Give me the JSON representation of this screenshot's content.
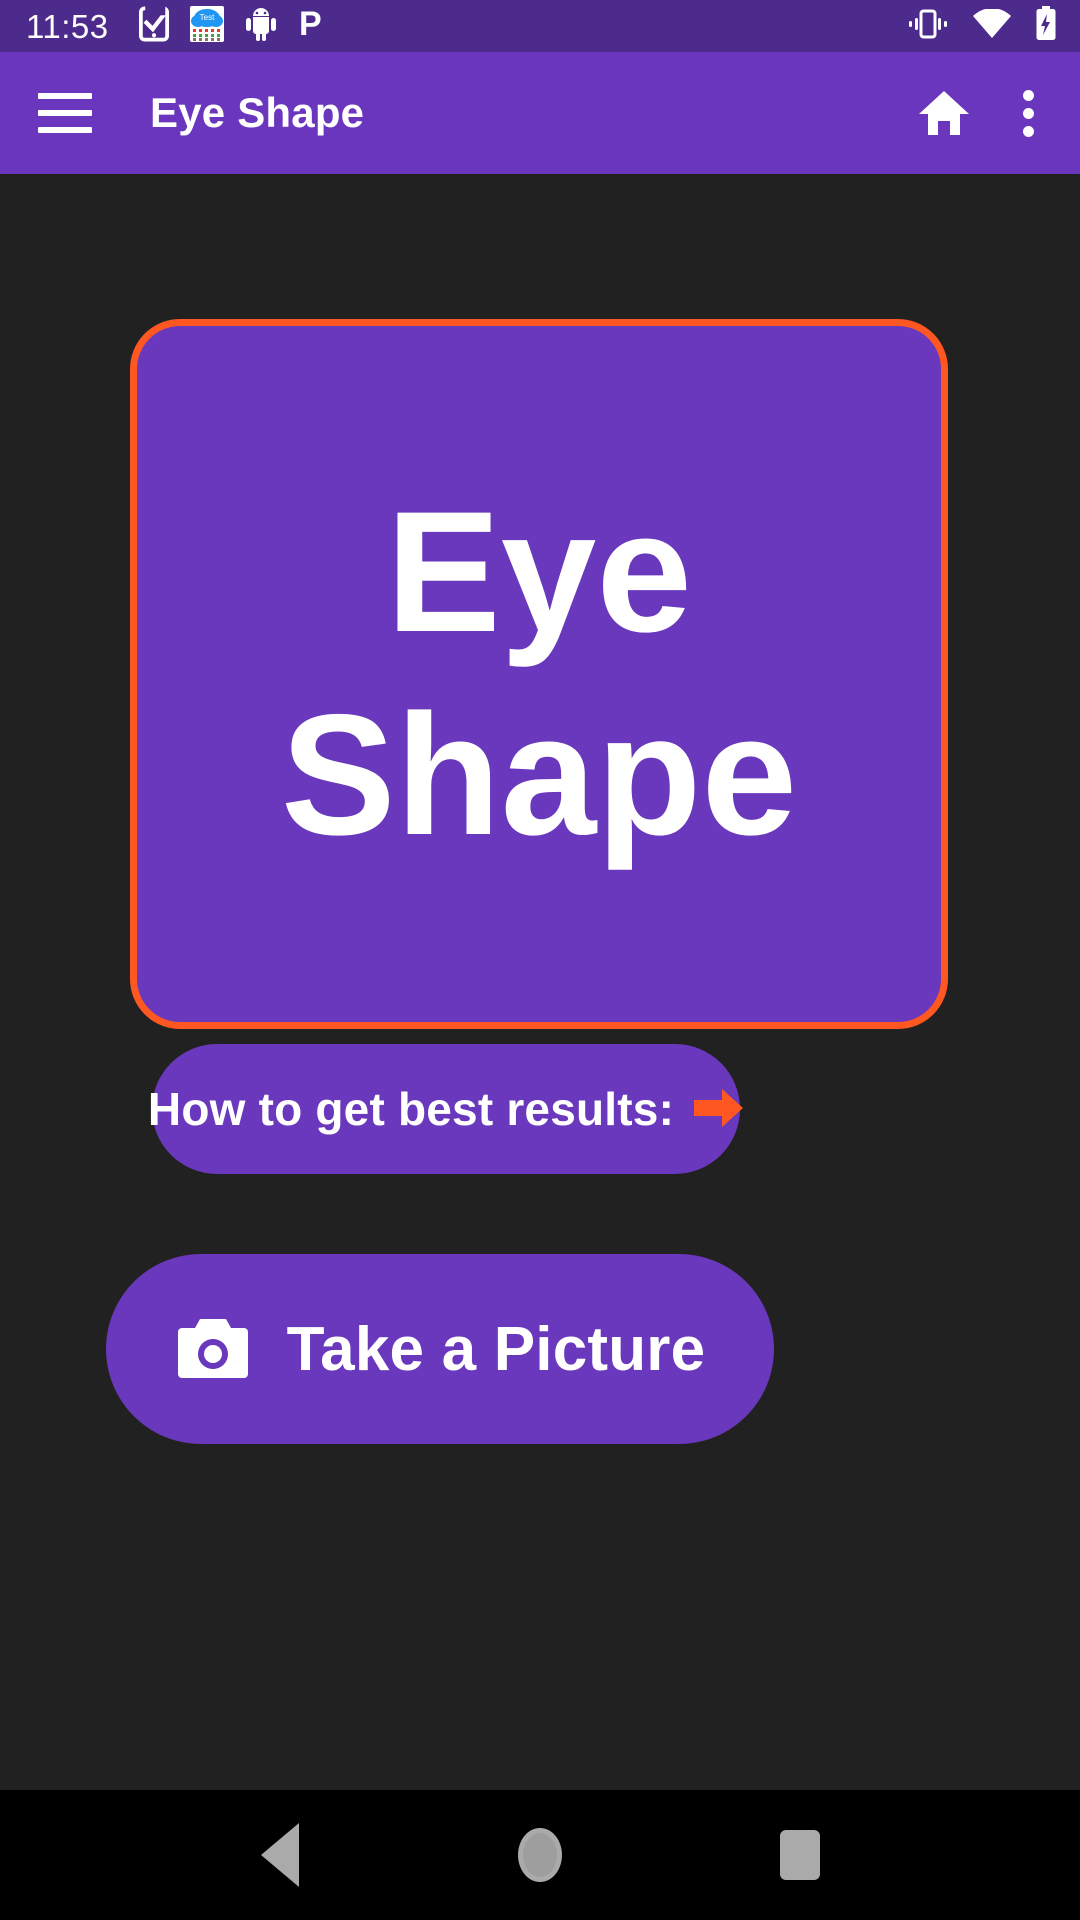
{
  "status_bar": {
    "time": "11:53",
    "background": "#4C2B8C",
    "notification_icons": [
      {
        "name": "phone-check-icon",
        "label": "phone with checkmark"
      },
      {
        "name": "weather-test-icon",
        "label": "Test"
      },
      {
        "name": "android-robot-icon",
        "label": "android"
      },
      {
        "name": "letter-p-icon",
        "label": "P"
      }
    ],
    "system_icons": [
      {
        "name": "vibrate-icon",
        "label": "vibrate"
      },
      {
        "name": "wifi-icon",
        "label": "wifi"
      },
      {
        "name": "battery-charging-icon",
        "label": "battery charging"
      }
    ]
  },
  "app_bar": {
    "title": "Eye Shape",
    "background": "#6A36BE",
    "menu_icon": "hamburger-icon",
    "home_icon": "home-icon",
    "overflow_icon": "more-vert-icon"
  },
  "main": {
    "background": "#212121",
    "title_card": {
      "text": "Eye Shape",
      "background": "#6938BC",
      "border_color": "#FF5722"
    },
    "results_button": {
      "label": "How to get best results:",
      "arrow_icon": "arrow-right-icon",
      "arrow_color": "#FF5722",
      "background": "#6938BC"
    },
    "picture_button": {
      "label": "Take a Picture",
      "icon": "camera-icon",
      "background": "#6938BC"
    }
  },
  "nav_bar": {
    "background": "#000000",
    "buttons": [
      {
        "name": "nav-back-button",
        "label": "Back"
      },
      {
        "name": "nav-home-button",
        "label": "Home"
      },
      {
        "name": "nav-recents-button",
        "label": "Recents"
      }
    ]
  }
}
